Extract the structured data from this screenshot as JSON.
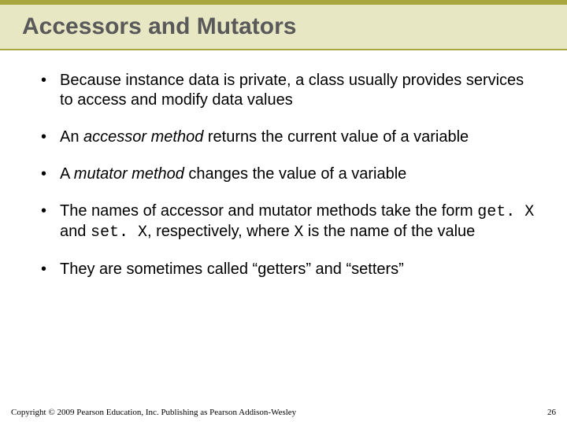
{
  "title": "Accessors and Mutators",
  "bullets": [
    {
      "pre": "Because instance data is private, a class usually provides services to access and modify data values"
    },
    {
      "pre": "An ",
      "em": "accessor method",
      "post": " returns the current value of a variable"
    },
    {
      "pre": "A ",
      "em": "mutator method",
      "post": " changes the value of a variable"
    },
    {
      "pre": "The names of accessor and mutator methods take the form ",
      "code1": "get. X",
      "mid": " and ",
      "code2": "set. X",
      "post2": ", respectively, where ",
      "code3": "X",
      "post3": " is the name of the value"
    },
    {
      "pre": "They are sometimes called “getters” and “setters”"
    }
  ],
  "footer": "Copyright © 2009 Pearson Education, Inc. Publishing as Pearson Addison-Wesley",
  "page": "26"
}
